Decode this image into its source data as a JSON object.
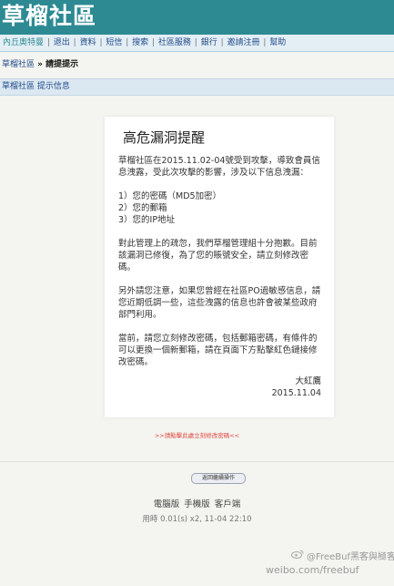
{
  "site": {
    "title": "草榴社區"
  },
  "nav": {
    "items": [
      "內丘奧特曼",
      "退出",
      "資料",
      "短信",
      "搜索",
      "社區服務",
      "銀行",
      "邀請注冊",
      "幫助"
    ],
    "separator": " | "
  },
  "breadcrumb": {
    "root": "草榴社區",
    "separator": " » ",
    "current": "請提提示"
  },
  "section_bar": {
    "text": "草榴社區 提示信息"
  },
  "notice": {
    "title": "高危漏洞提醒",
    "paragraph1": "草榴社區在2015.11.02-04號受到攻擊，導致會員信息洩露，受此次攻擊的影響，涉及以下信息洩漏：",
    "list": [
      "1）您的密碼（MD5加密）",
      "2）您的郵箱",
      "3）您的IP地址"
    ],
    "paragraph2": "對此管理上的疏忽，我們草榴管理組十分抱歉。目前該漏洞已修復，為了您的賬號安全，請立刻修改密碼。",
    "paragraph3": "另外請您注意，如果您曾經在社區PO過敏感信息，請您近期低調一些，這些洩露的信息也許會被某些政府部門利用。",
    "paragraph4": "當前，請您立刻修改密碼，包括郵箱密碼，有條件的可以更換一個新郵箱，請在頁面下方點擊紅色鏈接修改密碼。",
    "signature_name": "大紅鷹",
    "signature_date": "2015.11.04"
  },
  "red_link": {
    "text": ">>請點擊此處立刻修改密碼<<"
  },
  "home_button": {
    "label": "返回繼續操作"
  },
  "footer": {
    "versions": [
      "電腦版",
      "手機版",
      "客戶端"
    ],
    "time": "用時 0.01(s) x2, 11-04 22:10"
  },
  "watermark": {
    "handle": "@FreeBuf黑客與極客",
    "url": "weibo.com/freebuf"
  },
  "colors": {
    "header": "#2d8a93",
    "nav_bg": "#e3eef5",
    "section_bg": "#dbe8f2",
    "link_red": "#e0463e"
  }
}
